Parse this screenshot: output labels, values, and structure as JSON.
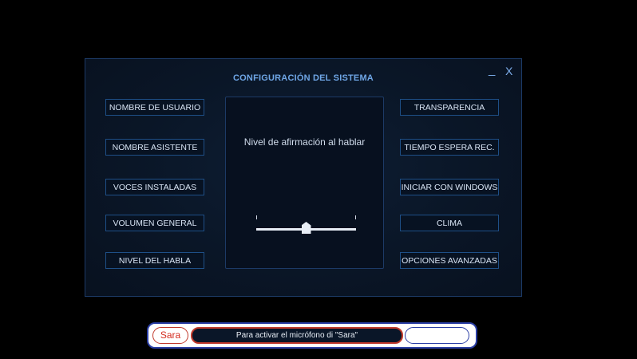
{
  "panel": {
    "title": "CONFIGURACIÓN DEL SISTEMA",
    "minimize_label": "_",
    "close_label": "X"
  },
  "left_buttons": [
    {
      "label": "NOMBRE DE USUARIO"
    },
    {
      "label": "NOMBRE ASISTENTE"
    },
    {
      "label": "VOCES INSTALADAS"
    },
    {
      "label": "VOLUMEN GENERAL"
    },
    {
      "label": "NIVEL DEL HABLA"
    }
  ],
  "right_buttons": [
    {
      "label": "TRANSPARENCIA"
    },
    {
      "label": "TIEMPO ESPERA REC."
    },
    {
      "label": "INICIAR CON WINDOWS"
    },
    {
      "label": "CLIMA"
    },
    {
      "label": "OPCIONES AVANZADAS"
    }
  ],
  "center": {
    "label": "Nivel de afirmación al hablar",
    "slider_level": 0.5
  },
  "bottom_bar": {
    "name_button": "Sara",
    "status_text": "Para activar el micrófono di \"Sara\"",
    "input_value": ""
  },
  "colors": {
    "accent": "#6fa6e6",
    "button_border": "#1e4f87",
    "alert": "#c0392b",
    "bar_border": "#2b3fa6"
  },
  "icons": {
    "minimize": "minimize-icon",
    "close": "close-icon"
  }
}
